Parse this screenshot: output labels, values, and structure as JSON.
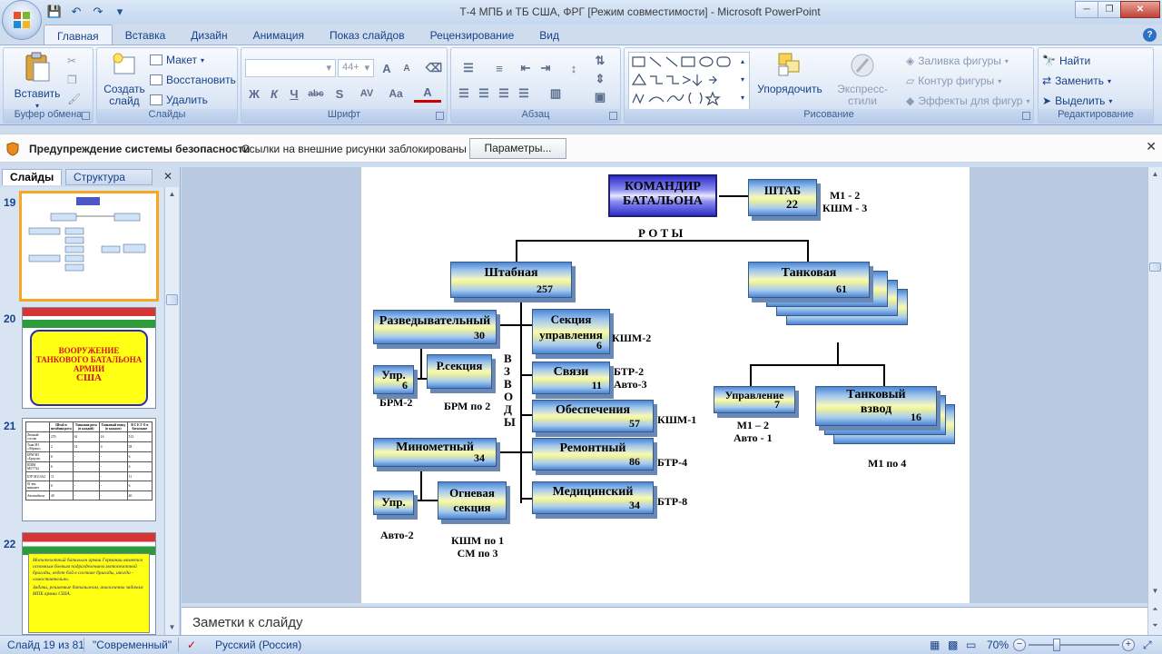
{
  "window": {
    "title": "Т-4 МПБ и ТБ США, ФРГ [Режим совместимости] - Microsoft PowerPoint",
    "minimize": "─",
    "maximize": "❐",
    "close": "✕"
  },
  "qat": {
    "save": "💾",
    "undo": "↶",
    "redo": "↷",
    "more": "▾"
  },
  "tabs": [
    {
      "label": "Главная"
    },
    {
      "label": "Вставка"
    },
    {
      "label": "Дизайн"
    },
    {
      "label": "Анимация"
    },
    {
      "label": "Показ слайдов"
    },
    {
      "label": "Рецензирование"
    },
    {
      "label": "Вид"
    }
  ],
  "ribbon": {
    "clipboard": {
      "paste": "Вставить",
      "label": "Буфер обмена"
    },
    "slides": {
      "create": "Создать слайд",
      "layout": "Макет",
      "reset": "Восстановить",
      "delete": "Удалить",
      "label": "Слайды"
    },
    "font": {
      "size": "44+",
      "label": "Шрифт",
      "b": "Ж",
      "i": "К",
      "u": "Ч",
      "s": "abc",
      "sh": "S",
      "spacing": "AV",
      "case": "Aa",
      "color": "A",
      "grow": "A",
      "shrink": "A"
    },
    "paragraph": {
      "label": "Абзац"
    },
    "drawing": {
      "arrange": "Упорядочить",
      "styles": "Экспресс-стили",
      "fill": "Заливка фигуры",
      "outline": "Контур фигуры",
      "effects": "Эффекты для фигур",
      "label": "Рисование"
    },
    "editing": {
      "find": "Найти",
      "replace": "Заменить",
      "select": "Выделить",
      "label": "Редактирование"
    }
  },
  "security": {
    "title": "Предупреждение системы безопасности",
    "message": "Ссылки на внешние рисунки заблокированы",
    "button": "Параметры..."
  },
  "pane": {
    "tab_slides": "Слайды",
    "tab_outline": "Структура",
    "close": "✕",
    "slides": [
      {
        "num": "19"
      },
      {
        "num": "20",
        "text": "ВООРУЖЕНИЕ ТАНКОВОГО БАТАЛЬОНА АРМИИ",
        "text2": "США"
      },
      {
        "num": "21"
      },
      {
        "num": "22",
        "text": "Мотопехотный батальон армии Германии является основным боевым подразделением мотопехотной бригады, ведет бой в составе бригады, иногда - самостоятельно.",
        "text2": "Задачи, решаемые батальоном, аналогичны задачам МПБ армии США."
      }
    ],
    "table21": {
      "headers": [
        "",
        "Штаб и штабная рота",
        "Танковая рота (в каждой)",
        "Танковый взвод (в каждом)",
        "В С Е Г О в батальоне"
      ],
      "rows": [
        [
          "Личный состав",
          "270",
          "61",
          "16",
          "513"
        ],
        [
          "Танк М1 «Абрамс»",
          "2",
          "14",
          "4",
          "58"
        ],
        [
          "БРМ М3 «Брэдли»",
          "6",
          "-",
          "-",
          "6"
        ],
        [
          "КШМ М577А2",
          "6",
          "-",
          "-",
          "6"
        ],
        [
          "БТР М113А2",
          "11",
          "-",
          "-",
          "11"
        ],
        [
          "81-мм миномет",
          "6",
          "-",
          "-",
          "6"
        ],
        [
          "Автомобили",
          "40",
          "-",
          "-",
          "40"
        ]
      ]
    }
  },
  "diagram": {
    "commander": "КОМАНДИР БАТАЛЬОНА",
    "hq": {
      "label": "ШТАБ",
      "num": "22"
    },
    "hq_note": "М1 - 2\nКШМ - 3",
    "roty": "Р О Т Ы",
    "hq_company": {
      "label": "Штабная",
      "num": "257"
    },
    "tank_company": {
      "label": "Танковая",
      "num": "61"
    },
    "recon": {
      "label": "Разведывательный",
      "num": "30"
    },
    "recon_upr": {
      "label": "Упр.",
      "num": "6"
    },
    "recon_sec": {
      "label": "Р.секция",
      "num": ""
    },
    "recon_upr_note": "БРМ-2",
    "recon_sec_note": "БРМ по 2",
    "vzvody": "В\nЗ\nВ\nО\nД\nЫ",
    "mortar": {
      "label": "Минометный",
      "num": "34"
    },
    "mortar_upr": {
      "label": "Упр.",
      "num": ""
    },
    "fire_sec": {
      "label": "Огневая секция",
      "num": ""
    },
    "mortar_upr_note": "Авто-2",
    "fire_sec_note": "КШМ по 1\nСМ по 3",
    "control_sec": {
      "label": "Секция управления",
      "num": "6"
    },
    "control_sec_note": "КШМ-2",
    "signal": {
      "label": "Связи",
      "num": "11"
    },
    "signal_note": "БТР-2\nАвто-3",
    "support": {
      "label": "Обеспечения",
      "num": "57"
    },
    "support_note": "КШМ-1",
    "repair": {
      "label": "Ремонтный",
      "num": "86"
    },
    "repair_note": "БТР-4",
    "medical": {
      "label": "Медицинский",
      "num": "34"
    },
    "medical_note": "БТР-8",
    "mgmt": {
      "label": "Управление",
      "num": "7"
    },
    "mgmt_note": "М1 – 2\nАвто - 1",
    "tank_platoon": {
      "label": "Танковый взвод",
      "num": "16"
    },
    "tank_platoon_note": "М1 по 4"
  },
  "notes": {
    "placeholder": "Заметки к слайду"
  },
  "status": {
    "slide": "Слайд 19 из 81",
    "theme": "\"Современный\"",
    "language": "Русский (Россия)",
    "zoom": "70%",
    "zoom_level": 70
  }
}
